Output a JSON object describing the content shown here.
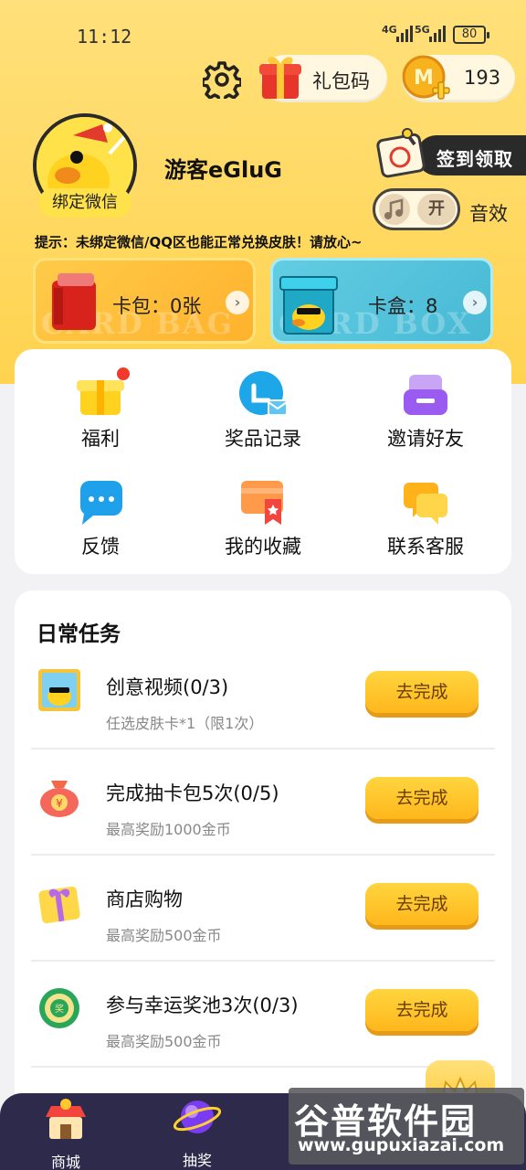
{
  "status_bar": {
    "time": "11:12",
    "net1": "4G",
    "net2": "5G",
    "battery": "80"
  },
  "header": {
    "gift_code_label": "礼包码",
    "coins": "193"
  },
  "profile": {
    "username": "游客eGluG",
    "bind_label": "绑定微信",
    "signin_label": "签到领取",
    "sound_state": "开",
    "sound_label": "音效",
    "tip": "提示：未绑定微信/QQ区也能正常兑换皮肤！请放心~"
  },
  "cards": {
    "pack_label": "卡包：0张",
    "pack_watermark": "CARD BAG",
    "box_label": "卡盒：8",
    "box_watermark": "CARD BOX"
  },
  "menu": {
    "items": [
      {
        "label": "福利",
        "icon": "gift-box-icon"
      },
      {
        "label": "奖品记录",
        "icon": "message-icon"
      },
      {
        "label": "邀请好友",
        "icon": "invite-icon"
      },
      {
        "label": "反馈",
        "icon": "chat-bubble-icon"
      },
      {
        "label": "我的收藏",
        "icon": "bookmark-icon"
      },
      {
        "label": "联系客服",
        "icon": "service-chat-icon"
      }
    ]
  },
  "tasks": {
    "title": "日常任务",
    "button_label": "去完成",
    "items": [
      {
        "name": "创意视频(0/3)",
        "sub": "任选皮肤卡*1（限1次）"
      },
      {
        "name": "完成抽卡包5次(0/5)",
        "sub": "最高奖励1000金币"
      },
      {
        "name": "商店购物",
        "sub": "最高奖励500金币"
      },
      {
        "name": "参与幸运奖池3次(0/3)",
        "sub": "最高奖励500金币"
      }
    ]
  },
  "nav": {
    "shop": "商城",
    "draw": "抽奖"
  },
  "watermark": {
    "brand": "谷普软件园",
    "url": "www.gupuxiazai.com"
  },
  "colors": {
    "brand_yellow": "#ffd34f",
    "nav_bg": "#2e2a4b",
    "button_yellow": "#ffc72c"
  }
}
